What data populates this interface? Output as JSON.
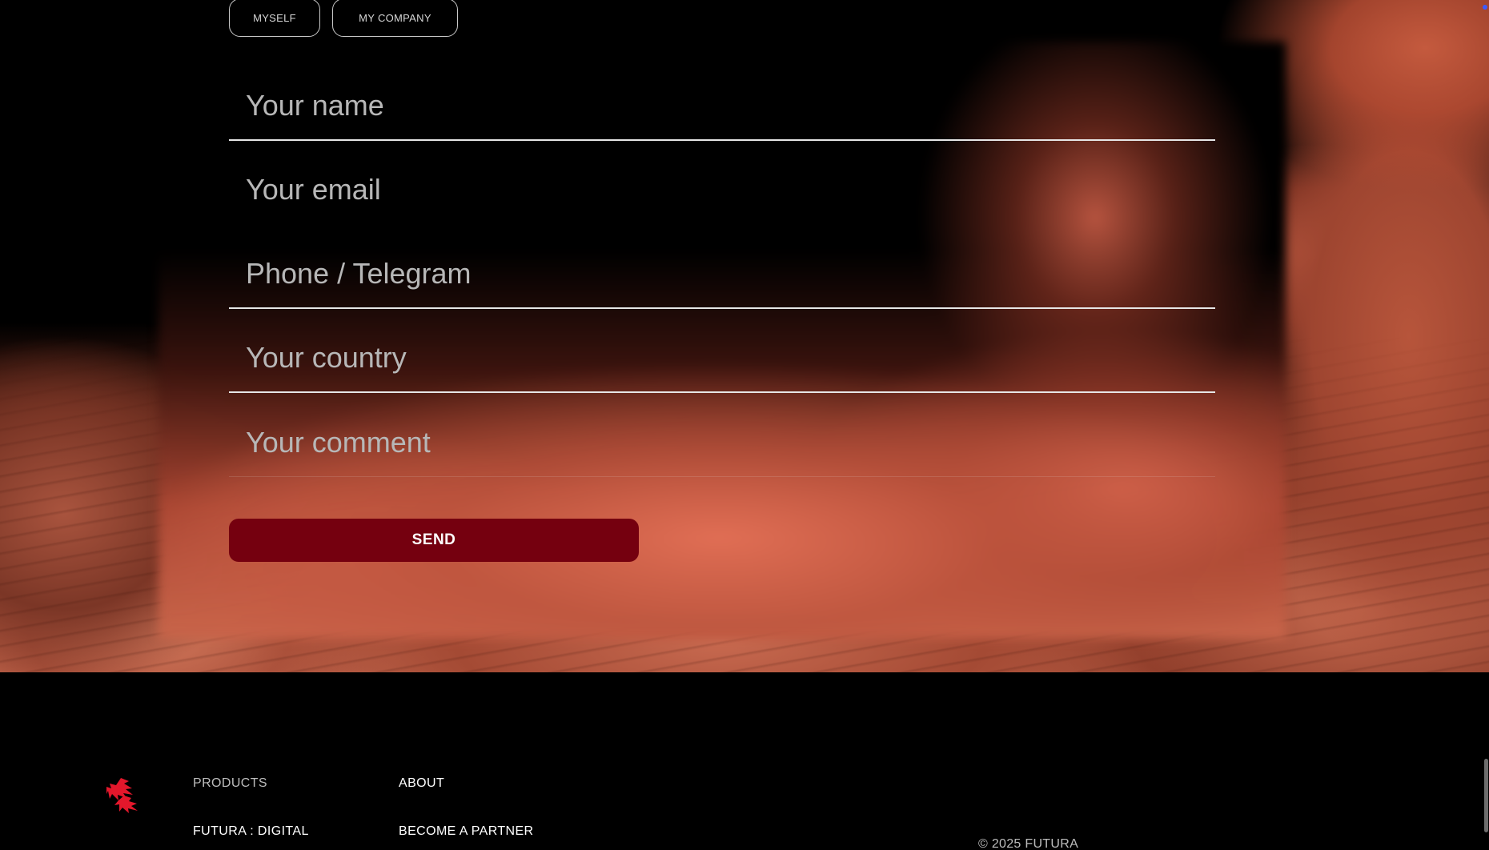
{
  "toggles": {
    "myself": "MYSELF",
    "company": "MY COMPANY"
  },
  "form": {
    "name_placeholder": "Your name",
    "email_placeholder": "Your email",
    "phone_placeholder": "Phone / Telegram",
    "country_placeholder": "Your country",
    "comment_placeholder": "Your comment",
    "send_label": "SEND"
  },
  "footer": {
    "logo_icon": "futura-logo-icon",
    "products": "PRODUCTS",
    "futura_digital": "FUTURA : DIGITAL",
    "about": "ABOUT",
    "become_partner": "BECOME A PARTNER",
    "copyright": "© 2025 FUTURA"
  },
  "colors": {
    "send_button": "#75000f",
    "logo": "#e3172b",
    "background": "#000000"
  }
}
